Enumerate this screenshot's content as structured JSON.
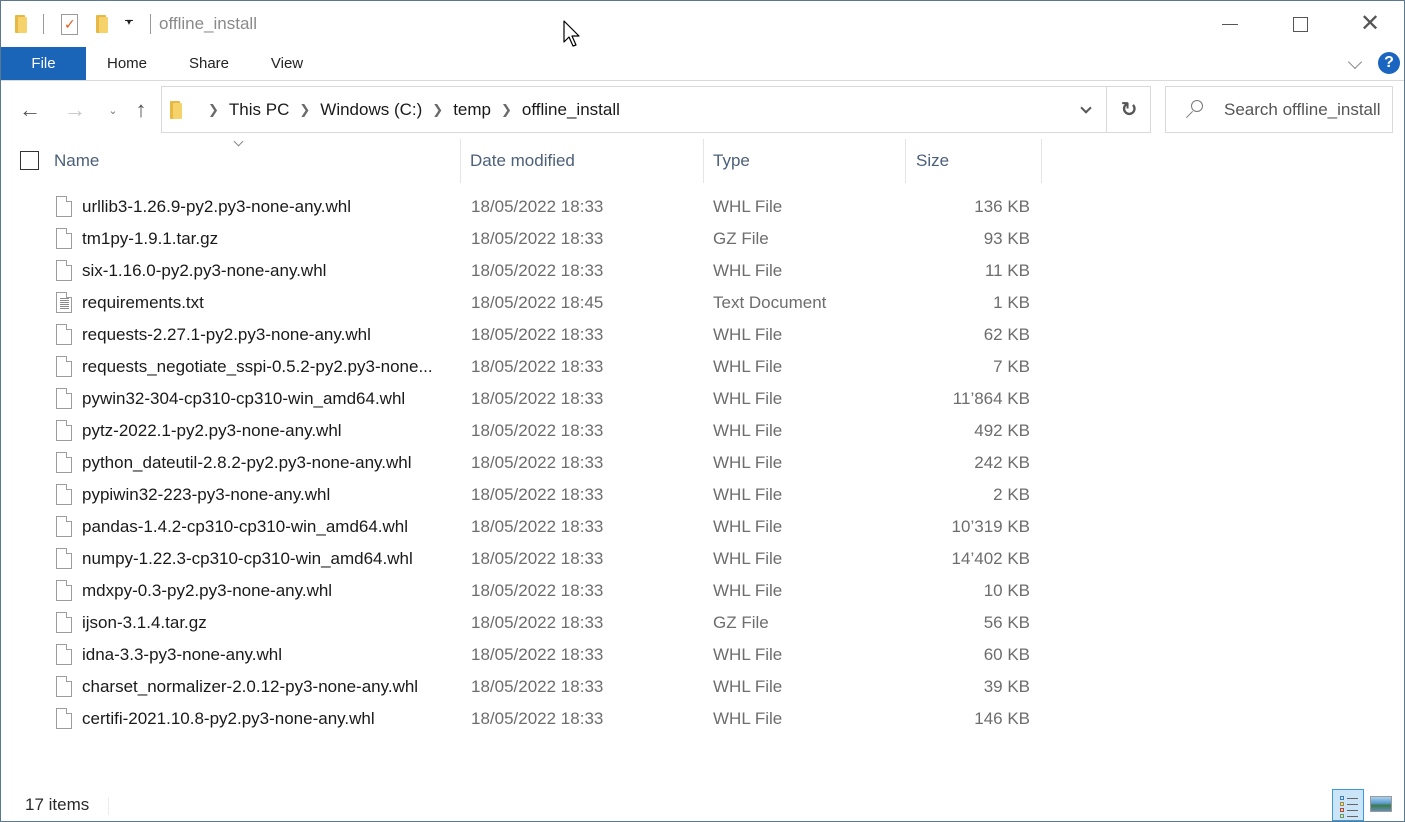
{
  "window": {
    "title": "offline_install",
    "controls": {
      "minimize": "minimize",
      "maximize": "maximize",
      "close": "close"
    }
  },
  "ribbon": {
    "tabs": [
      {
        "label": "File",
        "active": true
      },
      {
        "label": "Home"
      },
      {
        "label": "Share"
      },
      {
        "label": "View"
      }
    ],
    "help_label": "?",
    "accent_color": "#1a65b8"
  },
  "navigation": {
    "breadcrumbs": [
      "This PC",
      "Windows (C:)",
      "temp",
      "offline_install"
    ],
    "search_placeholder": "Search offline_install"
  },
  "columns": {
    "name": "Name",
    "date": "Date modified",
    "type": "Type",
    "size": "Size"
  },
  "files": [
    {
      "name": "urllib3-1.26.9-py2.py3-none-any.whl",
      "date": "18/05/2022 18:33",
      "type": "WHL File",
      "size": "136 KB",
      "icon": "file-icon"
    },
    {
      "name": "tm1py-1.9.1.tar.gz",
      "date": "18/05/2022 18:33",
      "type": "GZ File",
      "size": "93 KB",
      "icon": "file-icon"
    },
    {
      "name": "six-1.16.0-py2.py3-none-any.whl",
      "date": "18/05/2022 18:33",
      "type": "WHL File",
      "size": "11 KB",
      "icon": "file-icon"
    },
    {
      "name": "requirements.txt",
      "date": "18/05/2022 18:45",
      "type": "Text Document",
      "size": "1 KB",
      "icon": "text-file-icon"
    },
    {
      "name": "requests-2.27.1-py2.py3-none-any.whl",
      "date": "18/05/2022 18:33",
      "type": "WHL File",
      "size": "62 KB",
      "icon": "file-icon"
    },
    {
      "name": "requests_negotiate_sspi-0.5.2-py2.py3-none...",
      "date": "18/05/2022 18:33",
      "type": "WHL File",
      "size": "7 KB",
      "icon": "file-icon"
    },
    {
      "name": "pywin32-304-cp310-cp310-win_amd64.whl",
      "date": "18/05/2022 18:33",
      "type": "WHL File",
      "size": "11’864 KB",
      "icon": "file-icon"
    },
    {
      "name": "pytz-2022.1-py2.py3-none-any.whl",
      "date": "18/05/2022 18:33",
      "type": "WHL File",
      "size": "492 KB",
      "icon": "file-icon"
    },
    {
      "name": "python_dateutil-2.8.2-py2.py3-none-any.whl",
      "date": "18/05/2022 18:33",
      "type": "WHL File",
      "size": "242 KB",
      "icon": "file-icon"
    },
    {
      "name": "pypiwin32-223-py3-none-any.whl",
      "date": "18/05/2022 18:33",
      "type": "WHL File",
      "size": "2 KB",
      "icon": "file-icon"
    },
    {
      "name": "pandas-1.4.2-cp310-cp310-win_amd64.whl",
      "date": "18/05/2022 18:33",
      "type": "WHL File",
      "size": "10’319 KB",
      "icon": "file-icon"
    },
    {
      "name": "numpy-1.22.3-cp310-cp310-win_amd64.whl",
      "date": "18/05/2022 18:33",
      "type": "WHL File",
      "size": "14’402 KB",
      "icon": "file-icon"
    },
    {
      "name": "mdxpy-0.3-py2.py3-none-any.whl",
      "date": "18/05/2022 18:33",
      "type": "WHL File",
      "size": "10 KB",
      "icon": "file-icon"
    },
    {
      "name": "ijson-3.1.4.tar.gz",
      "date": "18/05/2022 18:33",
      "type": "GZ File",
      "size": "56 KB",
      "icon": "file-icon"
    },
    {
      "name": "idna-3.3-py3-none-any.whl",
      "date": "18/05/2022 18:33",
      "type": "WHL File",
      "size": "60 KB",
      "icon": "file-icon"
    },
    {
      "name": "charset_normalizer-2.0.12-py3-none-any.whl",
      "date": "18/05/2022 18:33",
      "type": "WHL File",
      "size": "39 KB",
      "icon": "file-icon"
    },
    {
      "name": "certifi-2021.10.8-py2.py3-none-any.whl",
      "date": "18/05/2022 18:33",
      "type": "WHL File",
      "size": "146 KB",
      "icon": "file-icon"
    }
  ],
  "status": {
    "item_count": "17 items"
  }
}
